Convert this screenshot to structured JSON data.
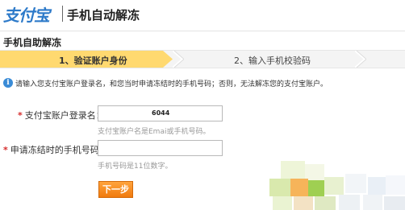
{
  "header": {
    "logo_text": "支付宝",
    "title": "手机自动解冻"
  },
  "section_title": "手机自助解冻",
  "steps": [
    {
      "label": "1、验证账户身份",
      "active": true
    },
    {
      "label": "2、输入手机校验码",
      "active": false
    }
  ],
  "info": {
    "icon": "info-icon",
    "text": "请输入您支付宝账户登录名，和您当时申请冻结时的手机号码；否则，无法解冻您的支付宝账户。"
  },
  "form": {
    "required_mark": "*",
    "login_label": "支付宝账户登录名：",
    "login_value": "6044",
    "login_hint": "支付宝账户名是Emai或手机号码。",
    "phone_label": "申请冻结时的手机号码：",
    "phone_value": "",
    "phone_hint": "手机号码是11位数字。",
    "next_label": "下一步"
  },
  "colors": {
    "step_active": "#ffd970",
    "button": "#f07a0d",
    "logo": "#2d7ac9",
    "required": "#d52a2a"
  }
}
